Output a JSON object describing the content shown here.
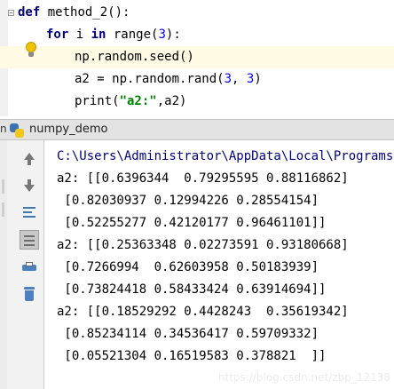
{
  "editor": {
    "lines": [
      {
        "parts": [
          {
            "t": "def",
            "c": "kw"
          },
          {
            "t": " method_2():",
            "c": ""
          }
        ]
      },
      {
        "parts": [
          {
            "t": "for",
            "c": "kw"
          },
          {
            "t": " i ",
            "c": ""
          },
          {
            "t": "in",
            "c": "kw"
          },
          {
            "t": " range(",
            "c": ""
          },
          {
            "t": "3",
            "c": "num"
          },
          {
            "t": "):",
            "c": ""
          }
        ]
      },
      {
        "parts": [
          {
            "t": "np.random.seed()",
            "c": ""
          }
        ]
      },
      {
        "parts": [
          {
            "t": "a2 = np.random.rand(",
            "c": ""
          },
          {
            "t": "3",
            "c": "num"
          },
          {
            "t": ", ",
            "c": ""
          },
          {
            "t": "3",
            "c": "num"
          },
          {
            "t": ")",
            "c": ""
          }
        ]
      },
      {
        "parts": [
          {
            "t": "print(",
            "c": ""
          },
          {
            "t": "\"a2:\"",
            "c": "str"
          },
          {
            "t": ",a2)",
            "c": ""
          }
        ]
      }
    ]
  },
  "run_panel": {
    "prefix": "n",
    "title": "numpy_demo"
  },
  "console": {
    "path_line": "C:\\Users\\Administrator\\AppData\\Local\\Programs\\P:",
    "output_lines": [
      "a2: [[0.6396344  0.79295595 0.88116862]",
      " [0.82030937 0.12994226 0.28554154]",
      " [0.52255277 0.42120177 0.96461101]]",
      "a2: [[0.25363348 0.02273591 0.93180668]",
      " [0.7266994  0.62603958 0.50183939]",
      " [0.73824418 0.58433424 0.63914694]]",
      "a2: [[0.18529292 0.4428243  0.35619342]",
      " [0.85234114 0.34536417 0.59709332]",
      " [0.05521304 0.16519583 0.378821  ]]"
    ]
  },
  "watermark": "https://blog.csdn.net/zbp_12138",
  "colors": {
    "keyword": "#000080",
    "string": "#008000",
    "number": "#0000ff",
    "highlight": "#fffae3"
  },
  "icons": {
    "fold": "fold-icon",
    "intention": "lightbulb-icon",
    "run_config": "python-icon",
    "toolbar": [
      "scroll-up-icon",
      "scroll-down-icon",
      "soft-wrap-icon",
      "scroll-to-end-icon",
      "print-icon",
      "clear-all-icon"
    ]
  }
}
